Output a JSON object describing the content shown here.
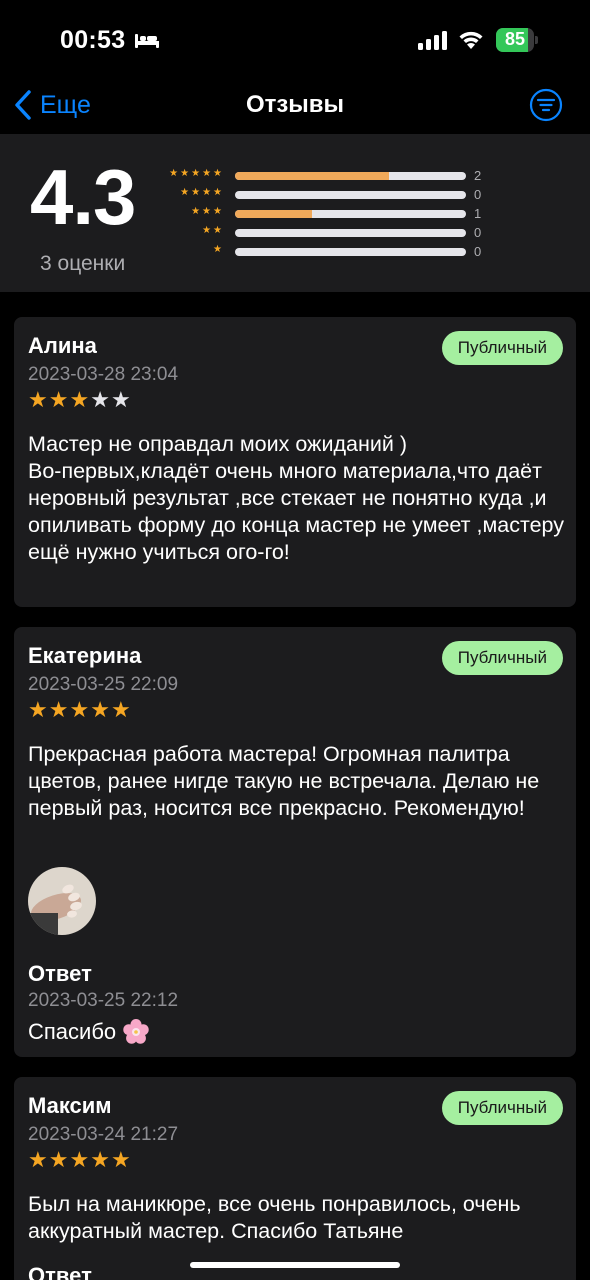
{
  "status": {
    "time": "00:53",
    "battery": "85",
    "battery_level": 0.85
  },
  "nav": {
    "back_label": "Еще",
    "title": "Отзывы"
  },
  "summary": {
    "average": "4.3",
    "count_label": "3 оценки",
    "distribution": [
      {
        "stars": "★★★★★",
        "count": "2",
        "fraction": 0.667
      },
      {
        "stars": "★★★★",
        "count": "0",
        "fraction": 0
      },
      {
        "stars": "★★★",
        "count": "1",
        "fraction": 0.333
      },
      {
        "stars": "★★",
        "count": "0",
        "fraction": 0
      },
      {
        "stars": "★",
        "count": "0",
        "fraction": 0
      }
    ]
  },
  "colors": {
    "accent": "#0a84ff",
    "star": "#f5a623",
    "badge_bg": "#a5efa0",
    "bar_fill": "#f0a95a"
  },
  "reviews": [
    {
      "author": "Алина",
      "badge": "Публичный",
      "date": "2023-03-28 23:04",
      "rating": 3,
      "text": "Мастер не оправдал моих ожиданий )\nВо-первых,кладёт очень много материала,что даёт неровный результат ,все стекает не понятно куда ,и опиливать форму до конца мастер не умеет ,мастеру ещё нужно учиться ого-го!"
    },
    {
      "author": "Екатерина",
      "badge": "Публичный",
      "date": "2023-03-25 22:09",
      "rating": 5,
      "text": "Прекрасная работа мастера! Огромная палитра цветов, ранее нигде такую не встречала. Делаю не первый раз, носится все прекрасно. Рекомендую!",
      "reply_label": "Ответ",
      "reply_date": "2023-03-25 22:12",
      "reply_text": "Спасибо"
    },
    {
      "author": "Максим",
      "badge": "Публичный",
      "date": "2023-03-24 21:27",
      "rating": 5,
      "text": "Был на маникюре, все очень понравилось, очень аккуратный мастер. Спасибо Татьяне",
      "reply_label": "Ответ"
    }
  ]
}
